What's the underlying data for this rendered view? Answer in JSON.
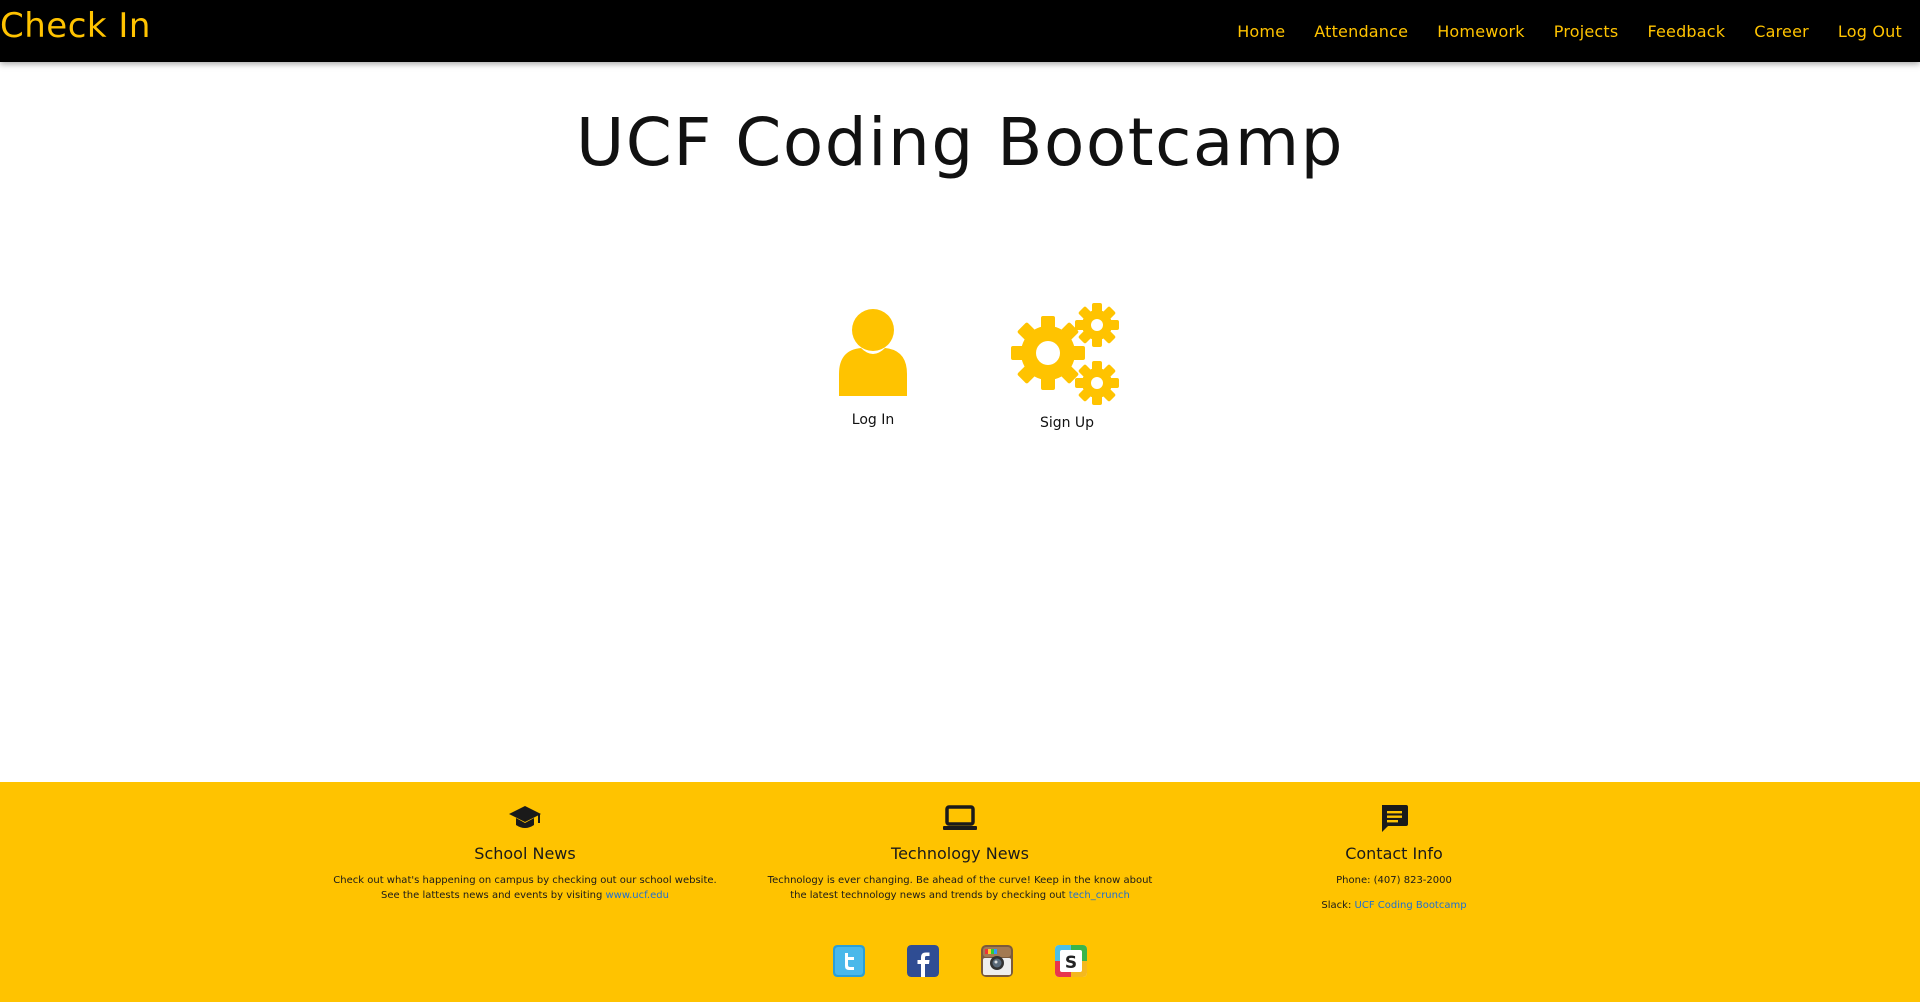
{
  "navbar": {
    "brand": "Check In",
    "links": [
      "Home",
      "Attendance",
      "Homework",
      "Projects",
      "Feedback",
      "Career",
      "Log Out"
    ]
  },
  "main": {
    "title": "UCF Coding Bootcamp",
    "actions": [
      {
        "label": "Log In",
        "icon": "user-icon"
      },
      {
        "label": "Sign Up",
        "icon": "gears-icon"
      }
    ]
  },
  "footer": {
    "school": {
      "icon": "graduation-cap-icon",
      "heading": "School News",
      "text": "Check out what's happening on campus by checking out our school website. See the lattests news and events by visiting ",
      "link": "www.ucf.edu"
    },
    "tech": {
      "icon": "laptop-icon",
      "heading": "Technology News",
      "text": "Technology is ever changing. Be ahead of the curve! Keep in the know about the latest technology news and trends by checking out ",
      "link": "tech_crunch"
    },
    "contact": {
      "icon": "chat-icon",
      "heading": "Contact Info",
      "phone": "Phone: (407) 823-2000",
      "slack_label": "Slack: ",
      "slack_link": "UCF Coding Bootcamp"
    },
    "social": [
      "twitter-icon",
      "facebook-icon",
      "instagram-icon",
      "slack-icon"
    ]
  },
  "colors": {
    "accent": "#ffc300",
    "navbar_bg": "#000000",
    "link": "#1e6fd0"
  }
}
